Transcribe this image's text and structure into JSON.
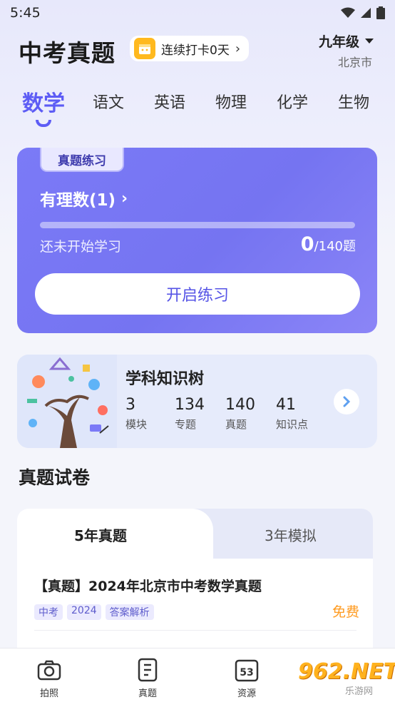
{
  "status_bar": {
    "time": "5:45"
  },
  "header": {
    "title": "中考真题",
    "streak_label": "连续打卡0天",
    "grade": "九年级",
    "city": "北京市"
  },
  "subject_tabs": [
    {
      "label": "数学",
      "active": true
    },
    {
      "label": "语文",
      "active": false
    },
    {
      "label": "英语",
      "active": false
    },
    {
      "label": "物理",
      "active": false
    },
    {
      "label": "化学",
      "active": false
    },
    {
      "label": "生物",
      "active": false
    }
  ],
  "practice_card": {
    "tag": "真题练习",
    "chapter": "有理数(1)",
    "status": "还未开始学习",
    "done": "0",
    "total": "/140题",
    "progress": 0,
    "button": "开启练习"
  },
  "knowledge_tree": {
    "title": "学科知识树",
    "stats": [
      {
        "value": "3",
        "label": "模块"
      },
      {
        "value": "134",
        "label": "专题"
      },
      {
        "value": "140",
        "label": "真题"
      },
      {
        "value": "41",
        "label": "知识点"
      }
    ]
  },
  "papers": {
    "section_title": "真题试卷",
    "tabs": [
      "5年真题",
      "3年模拟"
    ],
    "items": [
      {
        "title": "【真题】2024年北京市中考数学真题",
        "tags": [
          "中考",
          "2024",
          "答案解析"
        ],
        "price": "免费"
      }
    ]
  },
  "bottom_nav": [
    {
      "label": "拍照",
      "icon": "camera-icon"
    },
    {
      "label": "真题",
      "icon": "document-icon"
    },
    {
      "label": "资源",
      "icon": "calendar-53-icon",
      "badge": "53"
    }
  ],
  "watermark": {
    "brand": "962.NET",
    "sub": "乐游网"
  },
  "colors": {
    "accent": "#5d5cf5",
    "card": "#7574f1",
    "price": "#ff9a1e"
  }
}
